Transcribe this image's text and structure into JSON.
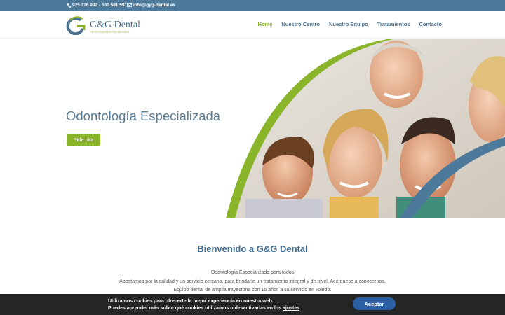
{
  "topbar": {
    "phone": "925 226 992 - 680 581 591",
    "email": "info@gyg-dental.es",
    "phone_icon": "phone-icon",
    "email_icon": "envelope-icon"
  },
  "header": {
    "logo_text": "G&G Dental",
    "logo_tagline": "ODONTOLOGÍA ESPECIALIZADA",
    "nav": [
      "Home",
      "Nuestro Centro",
      "Nuestro Equipo",
      "Tratamientos",
      "Contacto"
    ],
    "active_nav": "Home"
  },
  "hero": {
    "title": "Odontología Especializada",
    "cta_label": "Pide cita"
  },
  "welcome": {
    "title": "Bienvenido a G&G Dental",
    "lines": [
      "Odontología Especializada para todos",
      "Apostamos por la calidad y un servicio cercano, para brindarle un tratamiento integral y de nivel. Acérquese a conocernos.",
      "Equipo dental de amplia trayectoria con 15 años a su servicio en Toledo."
    ]
  },
  "cookie": {
    "line1": "Utilizamos cookies para ofrecerte la mejor experiencia en nuestra web.",
    "line2_prefix": "Puedes aprender más sobre qué cookies utilizamos o desactivarlas en los ",
    "line2_link": "ajustes",
    "line2_suffix": ".",
    "accept_label": "Aceptar"
  },
  "colors": {
    "brand_blue": "#4d7a9b",
    "brand_green": "#8ab42a",
    "cookie_bg": "#252525",
    "accept_button": "#2a5fa3"
  }
}
